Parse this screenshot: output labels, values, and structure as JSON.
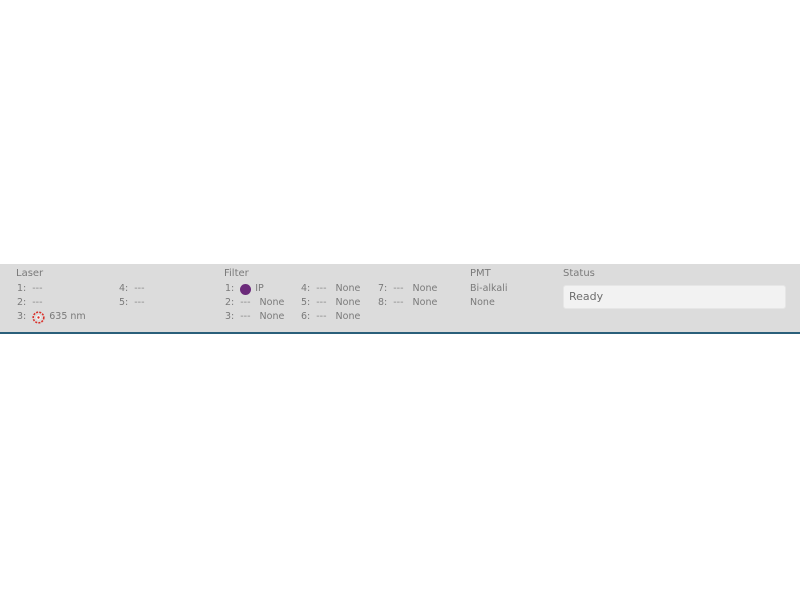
{
  "laser": {
    "title": "Laser",
    "items": [
      {
        "num": "1:",
        "value": "---"
      },
      {
        "num": "2:",
        "value": "---"
      },
      {
        "num": "3:",
        "icon": "laser-starburst-icon",
        "icon_color": "#d9302a",
        "value": "635 nm"
      },
      {
        "num": "4:",
        "value": "---"
      },
      {
        "num": "5:",
        "value": "---"
      }
    ]
  },
  "filter": {
    "title": "Filter",
    "items": [
      {
        "num": "1:",
        "icon": "filter-dot-icon",
        "icon_color": "#6b2a7a",
        "value": "IP"
      },
      {
        "num": "2:",
        "dash": "---",
        "value": "None"
      },
      {
        "num": "3:",
        "dash": "---",
        "value": "None"
      },
      {
        "num": "4:",
        "dash": "---",
        "value": "None"
      },
      {
        "num": "5:",
        "dash": "---",
        "value": "None"
      },
      {
        "num": "6:",
        "dash": "---",
        "value": "None"
      },
      {
        "num": "7:",
        "dash": "---",
        "value": "None"
      },
      {
        "num": "8:",
        "dash": "---",
        "value": "None"
      }
    ]
  },
  "pmt": {
    "title": "PMT",
    "values": [
      "Bi-alkali",
      "None"
    ]
  },
  "status": {
    "title": "Status",
    "value": "Ready"
  },
  "colors": {
    "panel_bg": "#dcdcdc",
    "bottom_border": "#2a5f7a"
  }
}
